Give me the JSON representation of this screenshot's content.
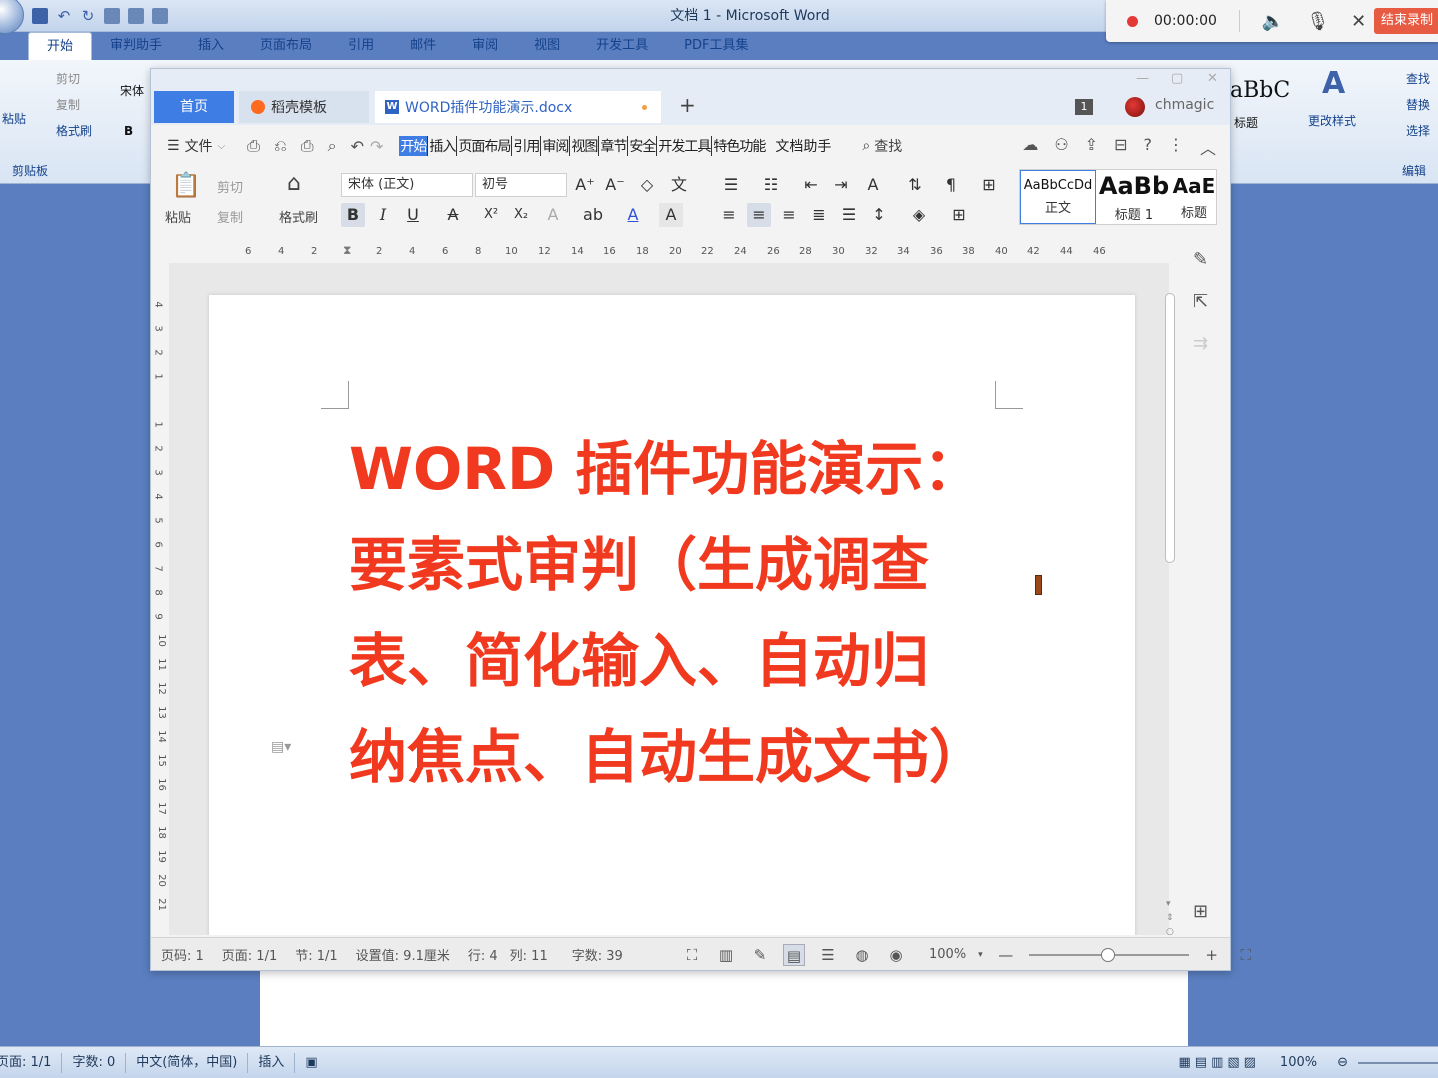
{
  "bg_word": {
    "title": "文档 1 - Microsoft Word",
    "tabs": [
      "开始",
      "审判助手",
      "插入",
      "页面布局",
      "引用",
      "邮件",
      "审阅",
      "视图",
      "开发工具",
      "PDF工具集"
    ],
    "active_tab": "开始",
    "ribbon_left": {
      "cut": "剪切",
      "copy": "复制",
      "format_painter": "格式刷",
      "paste": "粘贴",
      "font_name": "宋体",
      "bold": "B",
      "clipboard_group": "剪贴板"
    },
    "ribbon_right": {
      "style_preview": "aBbC",
      "style_label": "标题",
      "change_styles": "更改样式",
      "find": "查找",
      "replace": "替换",
      "select": "选择",
      "edit_group": "编辑"
    },
    "status": {
      "page": "页面: 1/1",
      "words": "字数: 0",
      "lang": "中文(简体，中国)",
      "mode": "插入",
      "zoom": "100%"
    }
  },
  "recorder": {
    "time": "00:00:00",
    "end_label": "结束录制"
  },
  "wps": {
    "tabs": {
      "home": "首页",
      "template": "稻壳模板",
      "doc": "WORD插件功能演示.docx"
    },
    "badge": "1",
    "user": "chmagic",
    "menu": {
      "file": "文件",
      "tabs": [
        "开始",
        "插入",
        "页面布局",
        "引用",
        "审阅",
        "视图",
        "章节",
        "安全",
        "开发工具",
        "特色功能"
      ],
      "active_tab": "开始",
      "doc_helper": "文档助手",
      "search": "查找"
    },
    "ribbon": {
      "paste": "粘贴",
      "cut": "剪切",
      "copy": "复制",
      "format_painter": "格式刷",
      "font_name": "宋体 (正文)",
      "font_size": "初号",
      "styles": [
        {
          "sample": "AaBbCcDd",
          "name": "正文"
        },
        {
          "sample": "AaBb",
          "name": "标题 1"
        },
        {
          "sample": "AaE",
          "name": "标题"
        }
      ]
    },
    "h_ruler_ticks": [
      "6",
      "4",
      "2",
      "2",
      "4",
      "6",
      "8",
      "10",
      "12",
      "14",
      "16",
      "18",
      "20",
      "22",
      "24",
      "26",
      "28",
      "30",
      "32",
      "34",
      "36",
      "38",
      "40",
      "42",
      "44",
      "46"
    ],
    "v_ruler_ticks": [
      "4",
      "3",
      "2",
      "1",
      "1",
      "2",
      "3",
      "4",
      "5",
      "6",
      "7",
      "8",
      "9",
      "10",
      "11",
      "12",
      "13",
      "14",
      "15",
      "16",
      "17",
      "18",
      "19",
      "20",
      "21"
    ],
    "document": {
      "lines": [
        "WORD 插件功能演示：",
        "要素式审判（生成调查",
        "表、简化输入、自动归",
        "纳焦点、自动生成文书）"
      ],
      "text_color": "#f0391e"
    },
    "status": {
      "page_no": "页码: 1",
      "pages": "页面: 1/1",
      "section": "节: 1/1",
      "setting": "设置值: 9.1厘米",
      "row": "行: 4",
      "col": "列: 11",
      "words": "字数: 39",
      "zoom": "100%",
      "zoom_percent": 100
    }
  }
}
